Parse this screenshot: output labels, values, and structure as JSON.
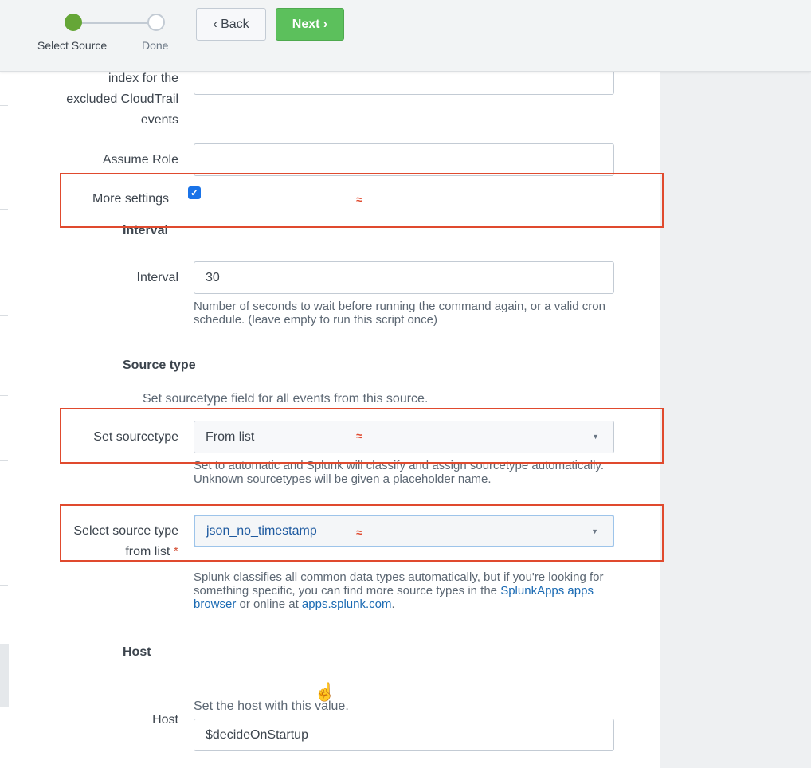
{
  "header": {
    "steps": [
      {
        "label": "Select Source",
        "state": "complete"
      },
      {
        "label": "Done",
        "state": "pending"
      }
    ],
    "back_label": "Back",
    "next_label": "Next"
  },
  "fields": {
    "excluded_index": {
      "label_lines": [
        "index for the",
        "excluded CloudTrail",
        "events"
      ],
      "value": ""
    },
    "assume_role": {
      "label": "Assume Role",
      "value": ""
    },
    "more_settings": {
      "label": "More settings",
      "checked": true
    }
  },
  "interval_section": {
    "title": "Interval",
    "label": "Interval",
    "value": "30",
    "help": "Number of seconds to wait before running the command again, or a valid cron schedule. (leave empty to run this script once)"
  },
  "sourcetype_section": {
    "title": "Source type",
    "description": "Set sourcetype field for all events from this source.",
    "set_label": "Set sourcetype",
    "set_value": "From list",
    "set_help": "Set to automatic and Splunk will classify and assign sourcetype automatically. Unknown sourcetypes will be given a placeholder name.",
    "select_label_lines": [
      "Select source type",
      "from list"
    ],
    "required_mark": "*",
    "select_value": "json_no_timestamp",
    "select_help_prefix": "Splunk classifies all common data types automatically, but if you're looking for something specific, you can find more source types in the ",
    "select_help_link1": "SplunkApps apps browser",
    "select_help_mid": " or online at ",
    "select_help_link2": "apps.splunk.com",
    "select_help_suffix": "."
  },
  "host_section": {
    "title": "Host",
    "label": "Host",
    "help": "Set the host with this value.",
    "value": "$decideOnStartup"
  },
  "annotation": {
    "mark": "≈",
    "color": "#e04a2e"
  },
  "icons": {
    "back": "chevron-left-icon",
    "next": "chevron-right-icon",
    "caret": "caret-down-icon",
    "check": "checkmark-icon",
    "cursor": "hand-pointer-icon"
  }
}
